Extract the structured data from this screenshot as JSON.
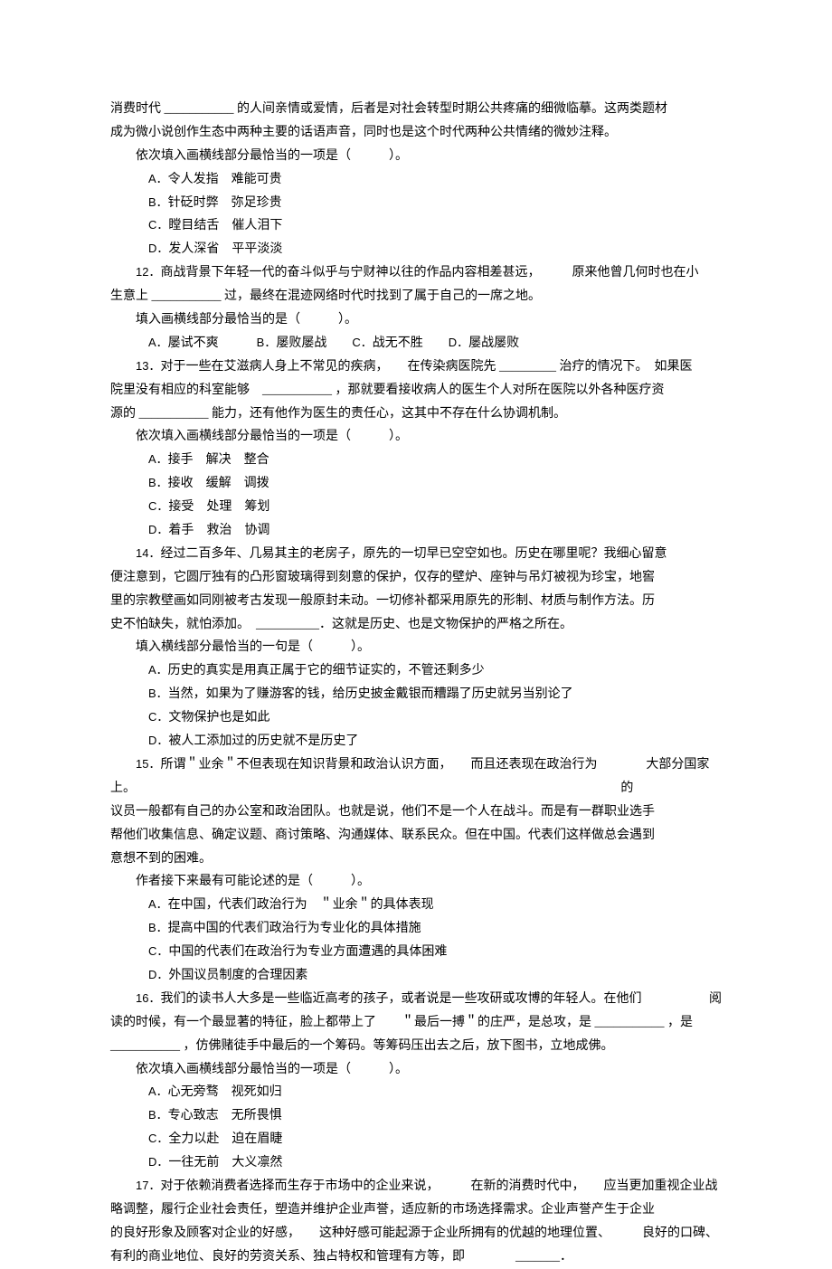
{
  "para_intro1": "消费时代 ___________ 的人间亲情或爱情，后者是对社会转型时期公共疼痛的细微临摹。这两类题材",
  "para_intro2": "成为微小说创作生态中两种主要的话语声音，同时也是这个时代两种公共情绪的微妙注释。",
  "q_fill_prompt": "依次填入画横线部分最恰当的一项是（　　　）。",
  "q11_optA": "令人发指　难能可贵",
  "q11_optB": "针砭时弊　弥足珍贵",
  "q11_optC": "瞠目结舌　催人泪下",
  "q11_optD": "发人深省　平平淡淡",
  "q12_line1": "商战背景下年轻一代的奋斗似乎与宁财神以往的作品内容相差甚远，　　　原来他曾几何时也在小",
  "q12_line2": "生意上 ___________ 过，最终在混迹网络时代时找到了属于自己的一席之地。",
  "q12_prompt": "填入画横线部分最恰当的是（　　　）。",
  "q12_opts": "屡试不爽　　　屡败屡战　　　战无不胜　　　屡战屡败",
  "q12_labelA": "A．",
  "q12_labelB": "B．",
  "q12_labelC": "C．",
  "q12_labelD": "D．",
  "q13_line1": "对于一些在艾滋病人身上不常见的疾病，　　在传染病医院先 _________ 治疗的情况下。　如果医",
  "q13_line2": "院里没有相应的科室能够　___________ ，那就要看接收病人的医生个人对所在医院以外各种医疗资",
  "q13_line3": "源的 ___________ 能力，还有他作为医生的责任心，这其中不存在什么协调机制。",
  "q13_optA": "接手　解决　整合",
  "q13_optB": "接收　缓解　调拨",
  "q13_optC": "接受　处理　筹划",
  "q13_optD": "着手　救治　协调",
  "q14_line1": "经过二百多年、几易其主的老房子，原先的一切早已空空如也。历史在哪里呢？我细心留意",
  "q14_line2": "便注意到，它圆厅独有的凸形窗玻璃得到刻意的保护，仅存的壁炉、座钟与吊灯被视为珍宝，地窖",
  "q14_line3": "里的宗教壁画如同刚被考古发现一般原封未动。一切修补都采用原先的形制、材质与制作方法。历",
  "q14_line4": "史不怕缺失，就怕添加。　__________．这就是历史、也是文物保护的严格之所在。",
  "q14_prompt": "填入横线部分最恰当的一句是（　　　）。",
  "q14_optA": "历史的真实是用真正属于它的细节证实的，不管还剩多少",
  "q14_optB": "当然，如果为了赚游客的钱，给历史披金戴银而糟蹋了历史就另当别论了",
  "q14_optC": "文物保护也是如此",
  "q14_optD": "被人工添加过的历史就不是历史了",
  "q15_line1a": "所谓＂业余＂不但表现在知识背景和政治认识方面，　　而且还表现在政治行为上。",
  "q15_line1b": "大部分国家的",
  "q15_line2": "议员一般都有自己的办公室和政治团队。也就是说，他们不是一个人在战斗。而是有一群职业选手",
  "q15_line3": "帮他们收集信息、确定议题、商讨策略、沟通媒体、联系民众。但在中国。代表们这样做总会遇到",
  "q15_line4": "意想不到的困难。",
  "q15_prompt": "作者接下来最有可能论述的是（　　　）。",
  "q15_optA": "在中国，代表们政治行为　＂业余＂的具体表现",
  "q15_optB": "提高中国的代表们政治行为专业化的具体措施",
  "q15_optC": "中国的代表们在政治行为专业方面遭遇的具体困难",
  "q15_optD": "外国议员制度的合理因素",
  "q16_line1a": "我们的读书人大多是一些临近高考的孩子，或者说是一些攻研或攻博的年轻人。在他们",
  "q16_line1b": "阅",
  "q16_line2a": "读的时候，有一个最显著的特征，脸上都带上了",
  "q16_line2b": "＂最后一搏＂的庄严，是总攻，是 ___________ ，是",
  "q16_line3": " ___________ ，仿佛赌徒手中最后的一个筹码。等筹码压出去之后，放下图书，立地成佛。",
  "q16_optA": "心无旁骛　视死如归",
  "q16_optB": "专心致志　无所畏惧",
  "q16_optC": "全力以赴　迫在眉睫",
  "q16_optD": "一往无前　大义凛然",
  "q17_line1": "对于依赖消费者选择而生存于市场中的企业来说，　　　在新的消费时代中，　　应当更加重视企业战",
  "q17_line2": "略调整，履行企业社会责任，塑造并维护企业声誉，适应新的市场选择需求。企业声誉产生于企业",
  "q17_line3": "的良好形象及顾客对企业的好感，　　这种好感可能起源于企业所拥有的优越的地理位置、　　　良好的口碑、",
  "q17_line4": "有利的商业地位、良好的劳资关系、独占特权和管理有方等，即　　　　_______．",
  "num12": "12．",
  "num13": "13．",
  "num14": "14．",
  "num15": "15．",
  "num16": "16．",
  "num17": "17．",
  "A": "A．",
  "B": "B．",
  "C": "C．",
  "D": "D．"
}
